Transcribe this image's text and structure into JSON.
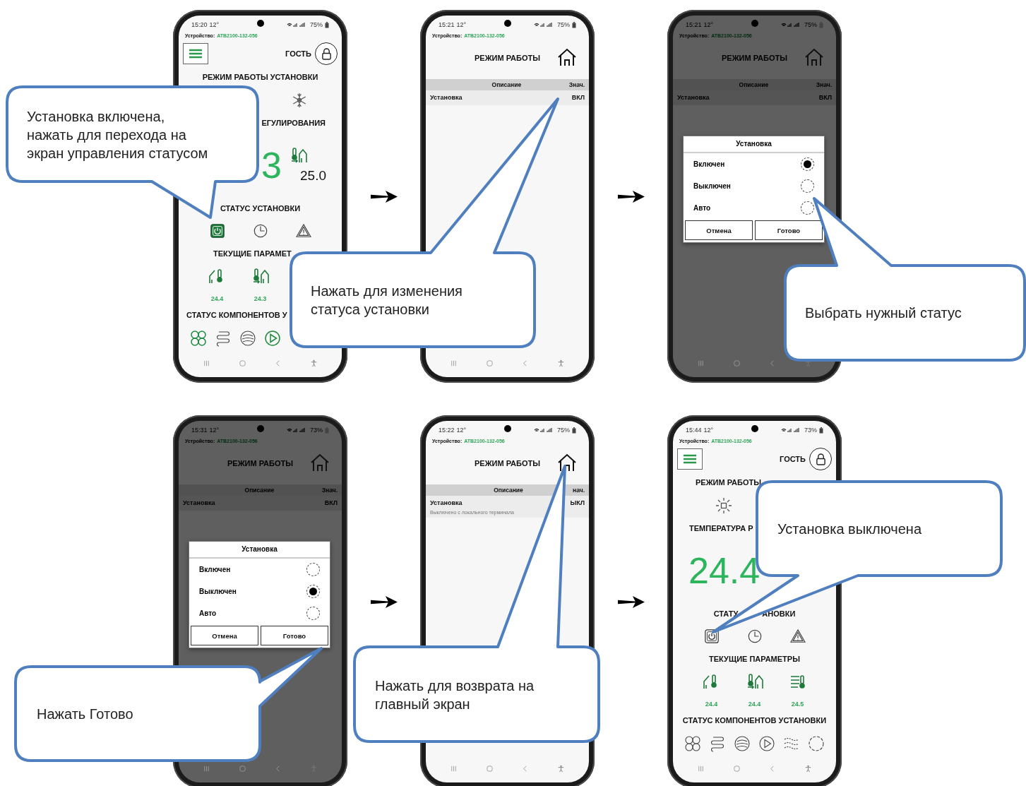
{
  "phones": [
    {
      "kind": "main",
      "dimmed": false,
      "time": "15:20",
      "temp": "12°",
      "battery": "75%",
      "device_label": "Устройство:",
      "device_id": "ATB2100-132-056",
      "user": "ГОСТЬ",
      "sections": [
        {
          "kind": "mode",
          "title": "РЕЖИМ РАБОТЫ УСТАНОВКИ",
          "icon": {
            "kind": "cooling"
          },
          "cut_start": true
        },
        {
          "kind": "regulation",
          "title": "ЕГУЛИРОВАНИЯ",
          "title_cut_start": true,
          "value": "3",
          "setpoint": "25.0",
          "cut_start": true
        },
        {
          "kind": "status",
          "title": "СТАТУС УСТАНОВКИ",
          "items": [
            {
              "kind": "power",
              "active": true
            },
            {
              "kind": "schedule",
              "active": false
            },
            {
              "kind": "alarm",
              "active": false
            }
          ]
        },
        {
          "kind": "params",
          "title": "ТЕКУЩИЕ ПАРАМЕТ",
          "title_cut_end": true,
          "items": [
            {
              "kind": "outdoor",
              "value": "24.4"
            },
            {
              "kind": "supply",
              "value": "24.3"
            }
          ]
        },
        {
          "kind": "components",
          "title": "СТАТУС КОМПОНЕНТОВ У",
          "title_cut_end": true,
          "items": [
            {
              "kind": "fan",
              "active": true
            },
            {
              "kind": "heater",
              "active": false
            },
            {
              "kind": "recuperator",
              "active": false
            },
            {
              "kind": "pump",
              "active": true
            }
          ]
        }
      ]
    },
    {
      "kind": "table",
      "dimmed": false,
      "time": "15:21",
      "temp": "12°",
      "battery": "75%",
      "device_label": "Устройство:",
      "device_id": "ATB2100-132-056",
      "title": "РЕЖИМ РАБОТЫ",
      "columns": [
        "Описание",
        "Знач."
      ],
      "rows": [
        {
          "name": "Установка",
          "value": "ВКЛ"
        }
      ]
    },
    {
      "kind": "table",
      "dimmed": true,
      "time": "15:21",
      "temp": "12°",
      "battery": "75%",
      "device_label": "Устройство:",
      "device_id": "ATB2100-132-056",
      "title": "РЕЖИМ РАБОТЫ",
      "columns": [
        "Описание",
        "Знач."
      ],
      "rows": [
        {
          "name": "Установка",
          "value": "ВКЛ"
        }
      ],
      "dialog": {
        "title": "Установка",
        "options": [
          {
            "label": "Включен",
            "selected": true
          },
          {
            "label": "Выключен",
            "selected": false
          },
          {
            "label": "Авто",
            "selected": false
          }
        ],
        "buttons": [
          "Отмена",
          "Готово"
        ]
      }
    },
    {
      "kind": "table",
      "dimmed": true,
      "time": "15:31",
      "temp": "12°",
      "battery": "73%",
      "device_label": "Устройство:",
      "device_id": "ATB2100-132-056",
      "title": "РЕЖИМ РАБОТЫ",
      "columns": [
        "Описание",
        "Знач."
      ],
      "rows": [
        {
          "name": "Установка",
          "value": "ВКЛ"
        }
      ],
      "dialog": {
        "title": "Установка",
        "options": [
          {
            "label": "Включен",
            "selected": false
          },
          {
            "label": "Выключен",
            "selected": true
          },
          {
            "label": "Авто",
            "selected": false
          }
        ],
        "buttons": [
          "Отмена",
          "Готово"
        ]
      }
    },
    {
      "kind": "table",
      "dimmed": false,
      "time": "15:22",
      "temp": "12°",
      "battery": "75%",
      "device_label": "Устройство:",
      "device_id": "ATB2100-132-056",
      "title": "РЕЖИМ РАБОТЫ",
      "columns": [
        "Описание",
        "нач."
      ],
      "rows": [
        {
          "name": "Установка",
          "value": "ЫКЛ",
          "note": "Выключено с локального терминала"
        }
      ]
    },
    {
      "kind": "main",
      "dimmed": false,
      "time": "15:44",
      "temp": "12°",
      "battery": "73%",
      "device_label": "Устройство:",
      "device_id": "ATB2100-132-056",
      "user": "ГОСТЬ",
      "sections": [
        {
          "kind": "mode",
          "title": "РЕЖИМ РАБОТЫ",
          "title_cut_end": true,
          "icon": {
            "kind": "heating"
          },
          "cut_end": true
        },
        {
          "kind": "regulation",
          "title": "ТЕМПЕРАТУРА Р",
          "title_cut_end": true,
          "value": "24.4",
          "cut_end": true
        },
        {
          "kind": "status",
          "title_parts": [
            "СТАТУ",
            "АНОВКИ"
          ],
          "items": [
            {
              "kind": "power",
              "active": false
            },
            {
              "kind": "schedule",
              "active": false
            },
            {
              "kind": "alarm",
              "active": false
            }
          ]
        },
        {
          "kind": "params",
          "title": "ТЕКУЩИЕ ПАРАМЕТРЫ",
          "items": [
            {
              "kind": "outdoor",
              "value": "24.4"
            },
            {
              "kind": "supply",
              "value": "24.4"
            },
            {
              "kind": "coil",
              "value": "24.5"
            }
          ]
        },
        {
          "kind": "components",
          "title": "СТАТУС КОМПОНЕНТОВ УСТАНОВКИ",
          "items": [
            {
              "kind": "fan",
              "active": false
            },
            {
              "kind": "heater",
              "active": false
            },
            {
              "kind": "recuperator",
              "active": false
            },
            {
              "kind": "pump",
              "active": false
            },
            {
              "kind": "filter",
              "active": false
            },
            {
              "kind": "cycle",
              "active": false
            }
          ]
        }
      ]
    }
  ],
  "callouts": [
    {
      "text": "Установка включена,\nнажать для перехода на\nэкран управления статусом"
    },
    {
      "text": "Нажать для изменения\nстатуса установки"
    },
    {
      "text": "Выбрать нужный статус"
    },
    {
      "text": "Нажать Готово"
    },
    {
      "text": "Нажать для возврата на\nглавный экран"
    },
    {
      "text": "Установка выключена"
    }
  ]
}
